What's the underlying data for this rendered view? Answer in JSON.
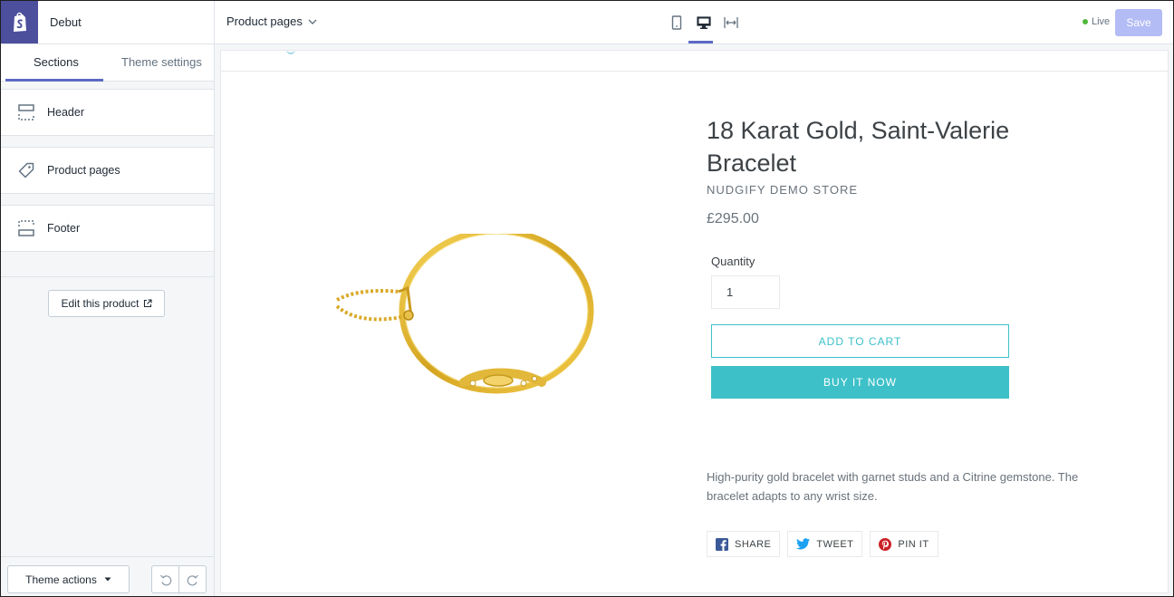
{
  "app": {
    "theme_name": "Debut",
    "page_selector": "Product pages",
    "status": "Live",
    "save_label": "Save",
    "accent_color": "#5c6ac4",
    "live_color": "#50b83c"
  },
  "sidebar": {
    "tabs": [
      {
        "label": "Sections",
        "active": true
      },
      {
        "label": "Theme settings",
        "active": false
      }
    ],
    "sections": [
      {
        "label": "Header",
        "icon": "header-section-icon"
      },
      {
        "label": "Product pages",
        "icon": "tag-icon"
      },
      {
        "label": "Footer",
        "icon": "footer-section-icon"
      }
    ],
    "edit_product_label": "Edit this product",
    "theme_actions_label": "Theme actions"
  },
  "preview": {
    "product": {
      "title": "18 Karat Gold, Saint-Valerie Bracelet",
      "vendor": "NUDGIFY DEMO STORE",
      "price": "£295.00",
      "quantity_label": "Quantity",
      "quantity_value": "1",
      "add_to_cart_label": "ADD TO CART",
      "buy_now_label": "BUY IT NOW",
      "description": "High-purity gold bracelet with garnet studs and a Citrine gemstone. The bracelet adapts to any wrist size.",
      "button_color": "#3dc0c8"
    },
    "share": [
      {
        "label": "SHARE",
        "icon": "facebook-icon"
      },
      {
        "label": "TWEET",
        "icon": "twitter-icon"
      },
      {
        "label": "PIN IT",
        "icon": "pinterest-icon"
      }
    ]
  }
}
